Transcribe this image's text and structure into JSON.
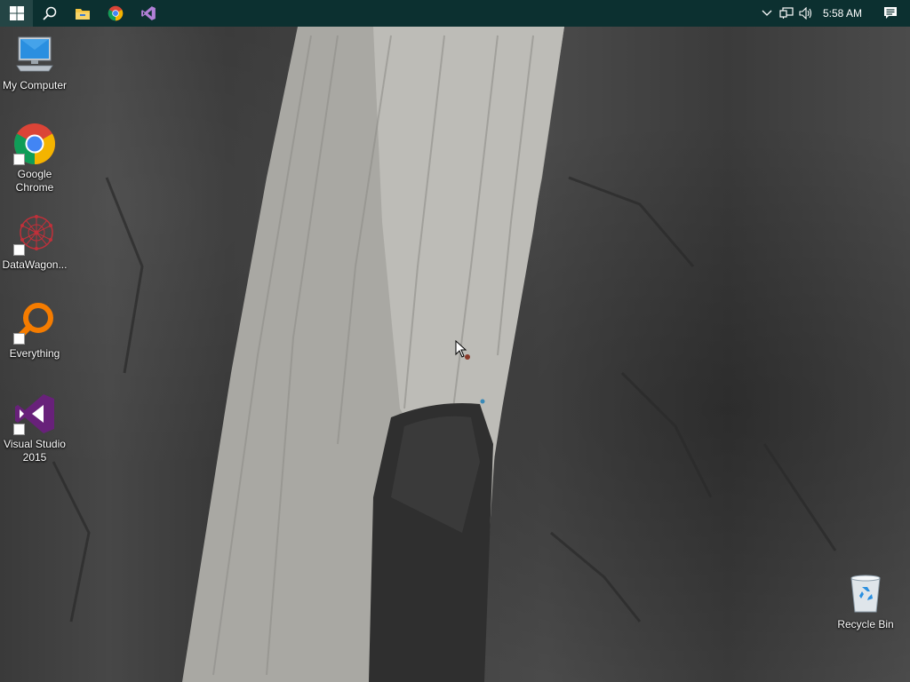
{
  "taskbar": {
    "start": {
      "icon": "windows-logo-icon"
    },
    "search": {
      "icon": "search-icon"
    },
    "pinned": [
      {
        "name": "file-explorer",
        "icon": "folder-icon"
      },
      {
        "name": "google-chrome",
        "icon": "chrome-icon"
      },
      {
        "name": "visual-studio",
        "icon": "visual-studio-icon"
      }
    ],
    "tray": {
      "overflow_icon": "chevron-up-icon",
      "network_icon": "network-icon",
      "volume_icon": "speaker-icon",
      "clock": "5:58 AM",
      "action_center_icon": "notification-icon"
    },
    "background": "#0c3030"
  },
  "desktop": {
    "icons": [
      {
        "id": "my-computer",
        "label": "My Computer",
        "icon": "monitor-icon",
        "shortcut": false
      },
      {
        "id": "google-chrome",
        "label": "Google Chrome",
        "icon": "chrome-icon",
        "shortcut": true
      },
      {
        "id": "datawagon",
        "label": "DataWagon...",
        "icon": "datawagon-icon",
        "shortcut": true
      },
      {
        "id": "everything",
        "label": "Everything",
        "icon": "everything-search-icon",
        "shortcut": true
      },
      {
        "id": "visual-studio-2015",
        "label": "Visual Studio 2015",
        "icon": "visual-studio-icon",
        "shortcut": true
      },
      {
        "id": "recycle-bin",
        "label": "Recycle Bin",
        "icon": "recycle-bin-icon",
        "shortcut": false
      }
    ]
  },
  "colors": {
    "chrome_red": "#db4437",
    "chrome_green": "#0f9d58",
    "chrome_yellow": "#f4b400",
    "chrome_blue": "#4285f4",
    "vs_purple": "#68217a",
    "everything_orange": "#f57c00",
    "datawagon_red": "#c0303a"
  }
}
